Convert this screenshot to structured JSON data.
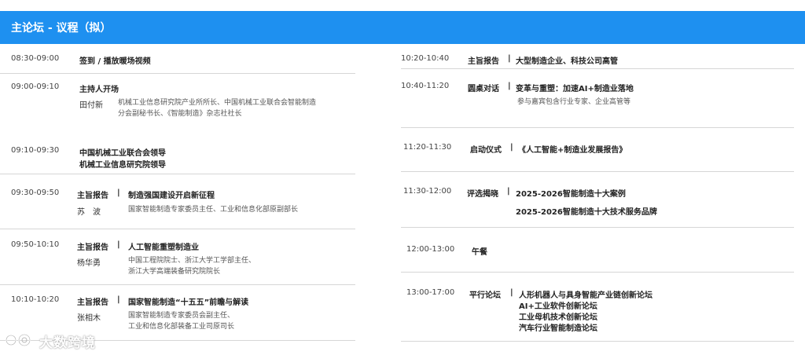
{
  "header": {
    "title": "主论坛 - 议程（拟）"
  },
  "left": {
    "r1": {
      "time": "08:30-09:00",
      "title": "签到 / 播放暖场视频"
    },
    "r2": {
      "time": "09:00-09:10",
      "title": "主持人开场",
      "person": "田付新",
      "desc1": "机械工业信息研究院产业所所长、中国机械工业联合会智能制造",
      "desc2": "分会副秘书长、《智能制造》杂志社社长"
    },
    "r3": {
      "time": "09:10-09:30",
      "title1": "中国机械工业联合会领导",
      "title2": "机械工业信息研究院领导"
    },
    "r4": {
      "time": "09:30-09:50",
      "tag": "主旨报告",
      "sep": "|",
      "title": "制造强国建设开启新征程",
      "person": "苏　波",
      "desc1": "国家智能制造专家委员主任、工业和信息化部原副部长"
    },
    "r5": {
      "time": "09:50-10:10",
      "tag": "主旨报告",
      "sep": "|",
      "title": "人工智能重塑制造业",
      "person": "杨华勇",
      "desc1": "中国工程院院士、浙江大学工学部主任、",
      "desc2": "浙江大学高端装备研究院院长"
    },
    "r6": {
      "time": "10:10-10:20",
      "tag": "主旨报告",
      "sep": "|",
      "title": "国家智能制造“十五五”前瞻与解读",
      "person": "张相木",
      "desc1": "国家智能制造专家委员会副主任、",
      "desc2": "工业和信息化部装备工业司原司长"
    }
  },
  "right": {
    "r1": {
      "time": "10:20-10:40",
      "tag": "主旨报告",
      "sep": "|",
      "title": "大型制造企业、科技公司高管"
    },
    "r2": {
      "time": "10:40-11:20",
      "tag": "圆桌对话",
      "sep": "|",
      "title": "变革与重塑：加速AI+制造业落地",
      "desc1": "参与嘉宾包含行业专家、企业高管等"
    },
    "r3": {
      "time": "11:20-11:30",
      "tag": "启动仪式",
      "sep": "|",
      "title": "《人工智能+制造业发展报告》"
    },
    "r4": {
      "time": "11:30-12:00",
      "tag": "评选揭晓",
      "sep": "|",
      "title1": "2025-2026智能制造十大案例",
      "title2": "2025-2026智能制造十大技术服务品牌"
    },
    "r5": {
      "time": "12:00-13:00",
      "title": "午餐"
    },
    "r6": {
      "time": "13:00-17:00",
      "tag": "平行论坛",
      "sep": "|",
      "title1": "人形机器人与具身智能产业链创新论坛",
      "title2": "AI+工业软件创新论坛",
      "title3": "工业母机技术创新论坛",
      "title4": "汽车行业智能制造论坛"
    }
  },
  "watermark": {
    "text": "大数跨境",
    "icon": "ok-hand-logo-icon"
  },
  "colors": {
    "header_bg": "#1e90f0",
    "divider": "#d6d6d6"
  }
}
